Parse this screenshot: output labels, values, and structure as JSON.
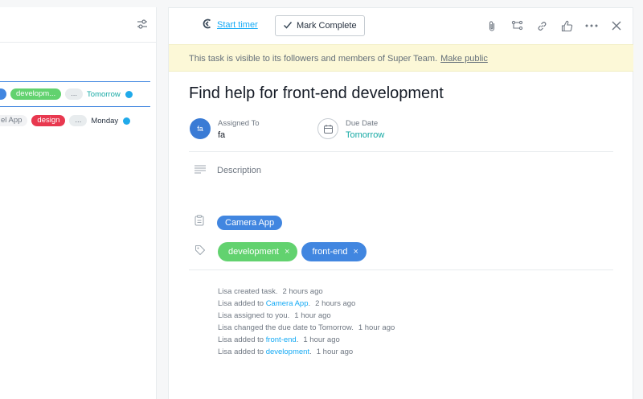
{
  "left_list": {
    "rows": [
      {
        "tags": [
          {
            "label": "",
            "color": "blue"
          },
          {
            "label": "developm...",
            "color": "green"
          },
          {
            "label": "...",
            "color": "grey"
          }
        ],
        "due": "Tomorrow",
        "due_color": "teal"
      },
      {
        "tags": [
          {
            "label": "el App",
            "color": "plain"
          },
          {
            "label": "design",
            "color": "red"
          },
          {
            "label": "...",
            "color": "grey"
          }
        ],
        "due": "Monday",
        "due_color": "dark"
      }
    ]
  },
  "toolbar": {
    "start_timer": "Start timer",
    "mark_complete": "Mark Complete",
    "icons": [
      "paperclip-icon",
      "subtask-icon",
      "link-icon",
      "like-icon",
      "more-icon",
      "close-icon"
    ]
  },
  "banner": {
    "text": "This task is visible to its followers and members of Super Team.",
    "link": "Make public"
  },
  "task": {
    "title": "Find help for front-end development",
    "assigned_label": "Assigned To",
    "assignee_initials": "fa",
    "assignee_name": "fa",
    "due_label": "Due Date",
    "due_value": "Tomorrow",
    "description_placeholder": "Description",
    "project": "Camera App",
    "tags": [
      {
        "label": "development",
        "remove": "×"
      },
      {
        "label": "front-end",
        "remove": "×"
      }
    ]
  },
  "activity": [
    {
      "text": "Lisa created task.",
      "link": "",
      "suffix": "",
      "time": "2 hours ago"
    },
    {
      "text": "Lisa added to ",
      "link": "Camera App",
      "suffix": ".",
      "time": "2 hours ago"
    },
    {
      "text": "Lisa assigned to you.",
      "link": "",
      "suffix": "",
      "time": "1 hour ago"
    },
    {
      "text": "Lisa changed the due date to Tomorrow.",
      "link": "",
      "suffix": "",
      "time": "1 hour ago"
    },
    {
      "text": "Lisa added to ",
      "link": "front-end",
      "suffix": ".",
      "time": "1 hour ago"
    },
    {
      "text": "Lisa added to ",
      "link": "development",
      "suffix": ".",
      "time": "1 hour ago"
    }
  ],
  "colors": {
    "accent_blue": "#4186e0",
    "tag_green": "#62d26f",
    "tag_red": "#e8384f",
    "teal": "#16a9a4",
    "link": "#14aaf5",
    "banner_bg": "#fcf8d7"
  }
}
